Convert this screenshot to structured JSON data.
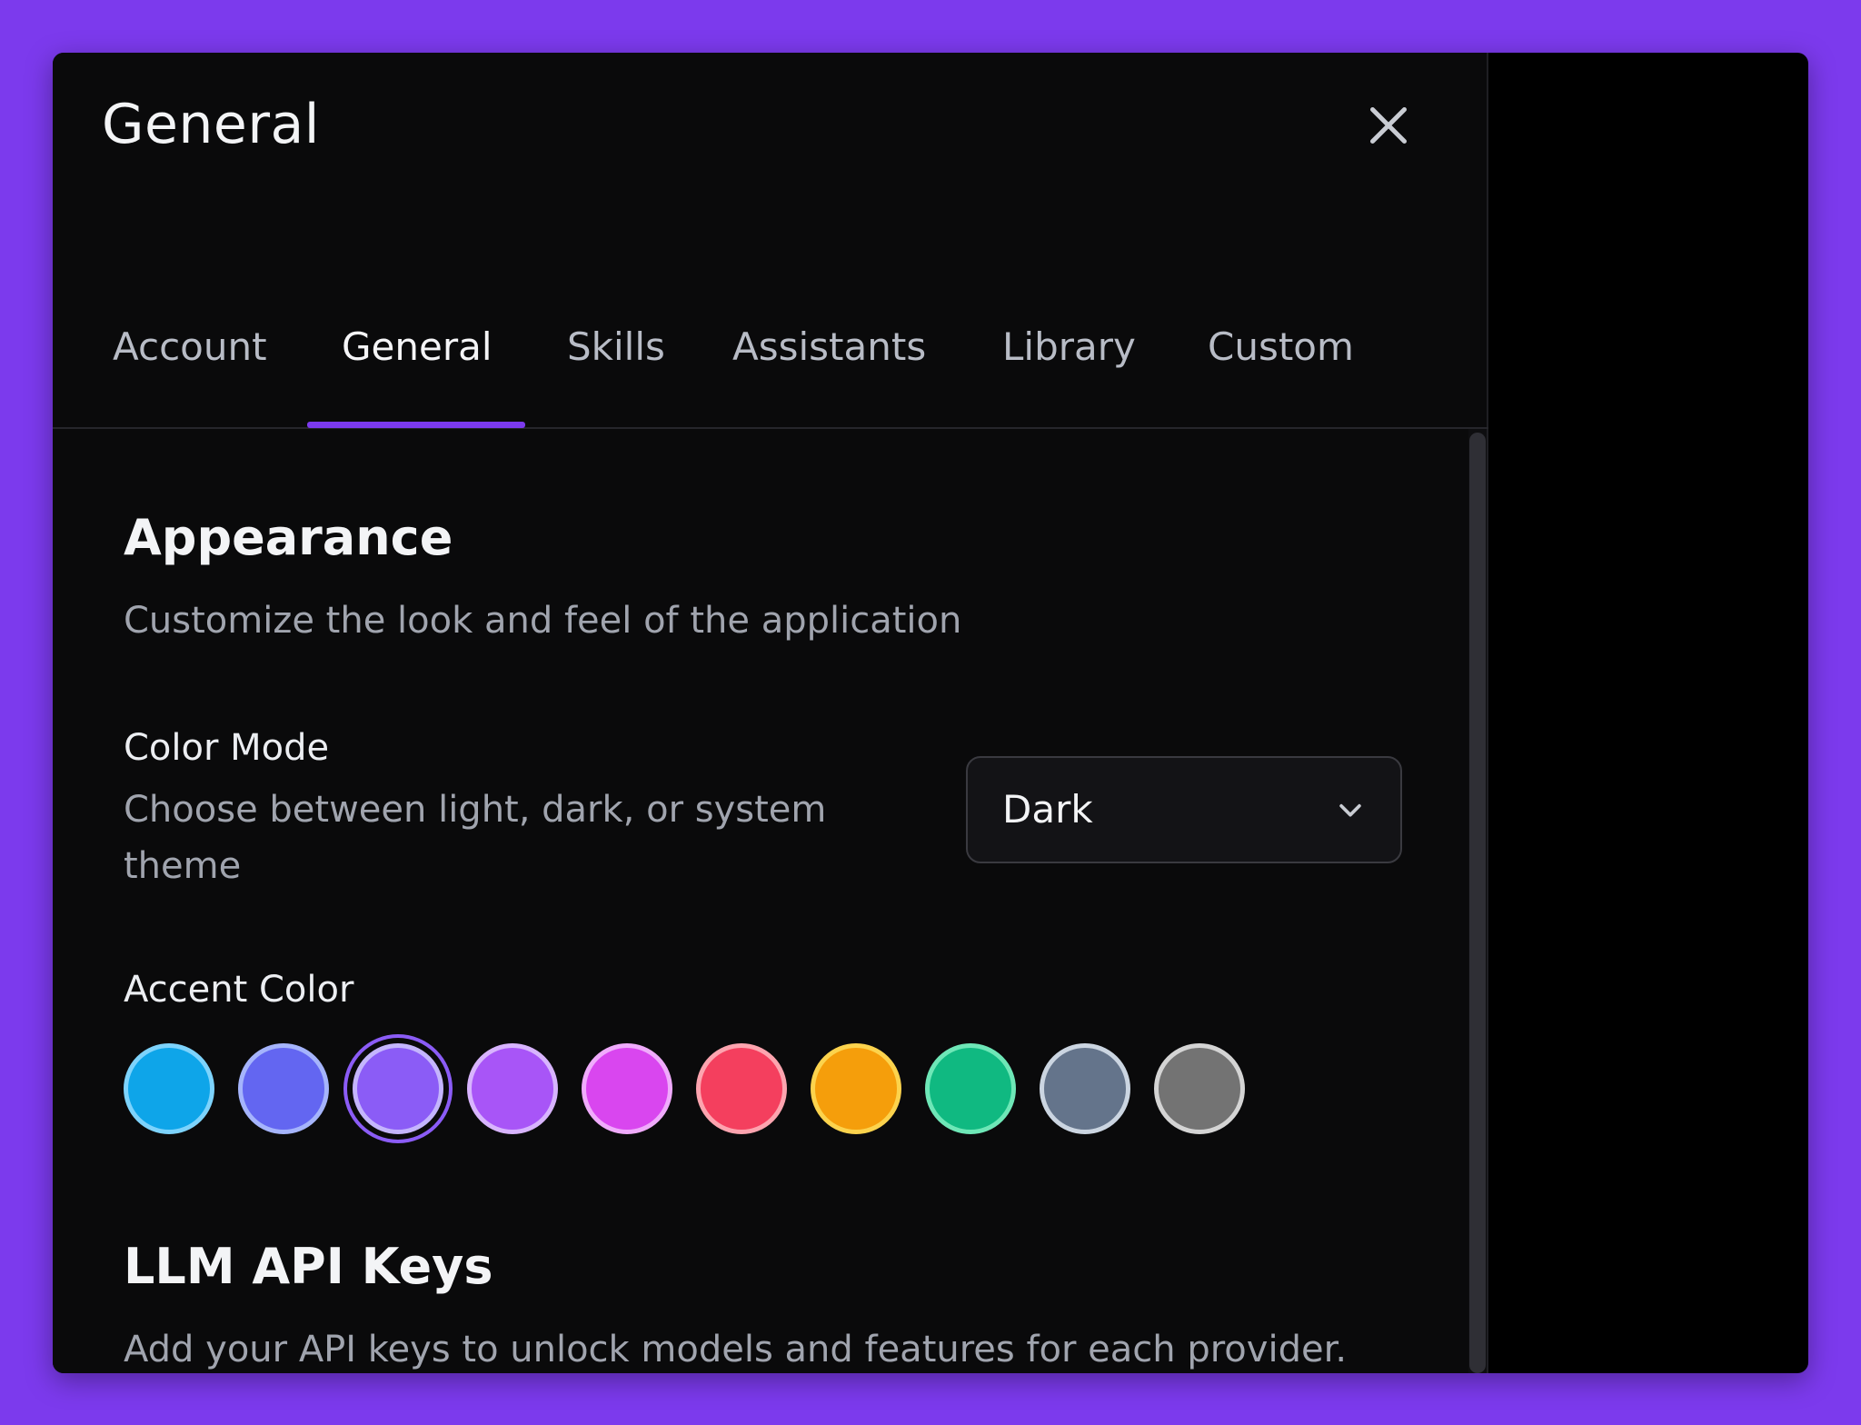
{
  "header": {
    "title": "General"
  },
  "tabs": [
    {
      "label": "Account"
    },
    {
      "label": "General",
      "active": true
    },
    {
      "label": "Skills"
    },
    {
      "label": "Assistants"
    },
    {
      "label": "Library"
    },
    {
      "label": "Custom"
    }
  ],
  "appearance": {
    "title": "Appearance",
    "description": "Customize the look and feel of the application",
    "color_mode": {
      "label": "Color Mode",
      "description": "Choose between light, dark, or system theme",
      "selected": "Dark"
    },
    "accent": {
      "label": "Accent Color",
      "selected_index": 2,
      "swatches": [
        {
          "fill": "#0ea5e9",
          "border": "#7dd3fc"
        },
        {
          "fill": "#6366f1",
          "border": "#a5b4fc"
        },
        {
          "fill": "#8b5cf6",
          "border": "#c4b5fd"
        },
        {
          "fill": "#a855f7",
          "border": "#d8b4fe"
        },
        {
          "fill": "#d946ef",
          "border": "#f0abfc"
        },
        {
          "fill": "#f43f5e",
          "border": "#fda4af"
        },
        {
          "fill": "#f59e0b",
          "border": "#fcd34d"
        },
        {
          "fill": "#10b981",
          "border": "#6ee7b7"
        },
        {
          "fill": "#64748b",
          "border": "#cbd5e1"
        },
        {
          "fill": "#737373",
          "border": "#d4d4d4"
        }
      ]
    }
  },
  "llm_api_keys": {
    "title": "LLM API Keys",
    "description": "Add your API keys to unlock models and features for each provider."
  },
  "colors": {
    "brand_background": "#7c3aed",
    "tab_indicator": "#7c3aed",
    "panel_background": "#0a0a0b"
  }
}
